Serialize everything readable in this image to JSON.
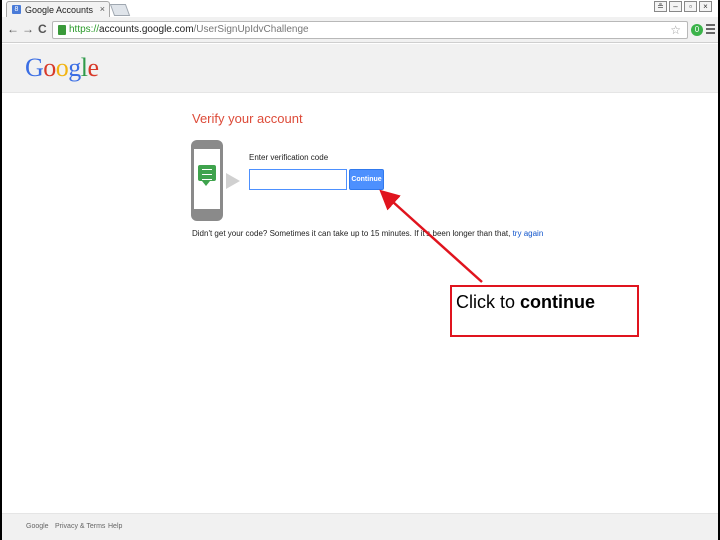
{
  "browser": {
    "tab_title": "Google Accounts",
    "tab_close": "×",
    "favicon_letter": "8",
    "url_scheme": "https://",
    "url_host": "accounts.google.com",
    "url_path": "/UserSignUpIdvChallenge",
    "nav_back": "←",
    "nav_forward": "→",
    "nav_reload": "C",
    "bookmark_star": "☆",
    "extension_badge": "0",
    "window_controls": [
      "≗",
      "–",
      "▫",
      "×"
    ]
  },
  "header": {
    "logo_letters": [
      "G",
      "o",
      "o",
      "g",
      "l",
      "e"
    ],
    "logo_colors": [
      "#3b6ee4",
      "#d83a2a",
      "#f2b413",
      "#3b6ee4",
      "#2f9a4a",
      "#d83a2a"
    ]
  },
  "verify": {
    "title": "Verify your account",
    "code_label": "Enter verification code",
    "code_value": "",
    "continue_label": "Continue",
    "help_before": "Didn't get your code? Sometimes it can take up to 15 minutes. If it's been longer than that, ",
    "help_link": "try again"
  },
  "annotation": {
    "prefix": "Click to ",
    "emphasis": "continue",
    "color": "#e0141e"
  },
  "footer": {
    "links": [
      "Google",
      "Privacy & Terms",
      "Help"
    ]
  }
}
